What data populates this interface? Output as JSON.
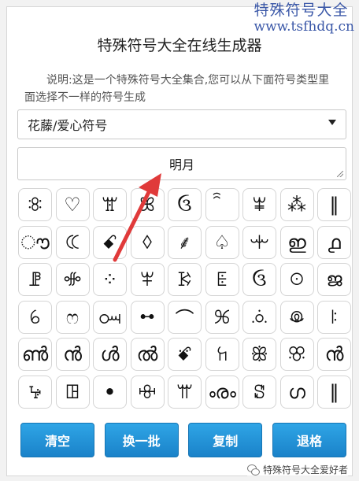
{
  "watermark_top": {
    "line1": "特殊符号大全",
    "line2": "www.tsfhdq.cn"
  },
  "header": {
    "title": "特殊符号大全在线生成器"
  },
  "description": "说明:这是一个特殊符号大全集合,您可以从下面符号类型里面选择不一样的符号生成",
  "category_select": {
    "selected": "花藤/爱心符号"
  },
  "output": {
    "value": "明月"
  },
  "symbols": [
    "ꖊ",
    "♡",
    "ꖂ",
    "ꕤ",
    "ઉ",
    "ꩰ",
    "ꕾ",
    "⁂",
    "‖",
    "ൗ",
    "ꕆ",
    "ꗃ",
    "ꕺ",
    "⸙",
    "♤",
    "ꗻ",
    "ഇ",
    "൧",
    "ꗘ",
    "ꗂ",
    "⁘",
    "ꕽ",
    "ꗣ",
    "ꗍ",
    "ઉ",
    "ꖴ",
    "ജ",
    "ꕃ",
    "ෆ",
    "ꗢ",
    "ꕹ",
    "⌒",
    "ꕑ",
    "ꗝ",
    "ꖘ",
    "ꖎ",
    "ൺ",
    "ൻ",
    "ൾ",
    "ൽ",
    "ꗄ",
    "ꖷ",
    "ꕥ",
    "ꕣ",
    "ൻ",
    "ꕵ",
    "ꖸ",
    "ꔷ",
    "ꗳ",
    "ꕌ",
    "ൟ",
    "ꗟ",
    "ഗ",
    "‖"
  ],
  "buttons": {
    "clear": "清空",
    "refresh": "换一批",
    "copy": "复制",
    "backspace": "退格"
  },
  "watermark_bottom": {
    "text": "特殊符号大全爱好者"
  },
  "colors": {
    "button": "#1e8fd8",
    "arrow": "#e03a3a",
    "brand_watermark": "#3b58a8"
  }
}
